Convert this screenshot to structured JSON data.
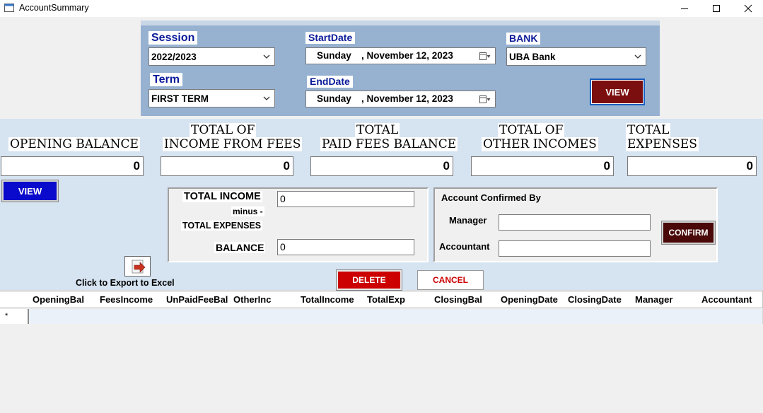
{
  "window": {
    "title": "AccountSummary",
    "controls": {
      "minimize": "—",
      "maximize": "☐",
      "close": "✕"
    }
  },
  "filter": {
    "session_label": "Session",
    "session_value": "2022/2023",
    "term_label": "Term",
    "term_value": "FIRST TERM",
    "start_label": "StartDate",
    "start_day": "Sunday",
    "start_rest": ", November 12, 2023",
    "end_label": "EndDate",
    "end_day": "Sunday",
    "end_rest": ", November 12, 2023",
    "bank_label": "BANK",
    "bank_value": "UBA Bank",
    "view_label": "VIEW"
  },
  "summary": {
    "opening_label": "OPENING BALANCE",
    "opening_value": "0",
    "fees_label_1": "TOTAL OF",
    "fees_label_2": "INCOME FROM FEES",
    "fees_value": "0",
    "paid_label_1": "TOTAL",
    "paid_label_2": "PAID FEES BALANCE",
    "paid_value": "0",
    "other_label_1": "TOTAL OF",
    "other_label_2": "OTHER INCOMES",
    "other_value": "0",
    "exp_label_1": "TOTAL",
    "exp_label_2": "EXPENSES",
    "exp_value": "0",
    "view_label": "VIEW"
  },
  "calc": {
    "income_label": "TOTAL INCOME",
    "income_value": "0",
    "minus_label": "minus -",
    "expenses_label": "TOTAL EXPENSES",
    "balance_label": "BALANCE",
    "balance_value": "0"
  },
  "confirm": {
    "title": "Account Confirmed By",
    "manager_label": "Manager",
    "manager_value": "",
    "accountant_label": "Accountant",
    "accountant_value": "",
    "confirm_label": "CONFIRM"
  },
  "actions": {
    "export_label": "Click to Export to Excel",
    "delete_label": "DELETE",
    "cancel_label": "CANCEL"
  },
  "grid": {
    "columns": [
      "OpeningBal",
      "FeesIncome",
      "UnPaidFeeBal",
      "OtherInc",
      "TotalIncome",
      "TotalExp",
      "ClosingBal",
      "OpeningDate",
      "ClosingDate",
      "Manager",
      "Accountant"
    ],
    "new_row_marker": "*"
  },
  "colors": {
    "panel_blue": "#97b2d1",
    "band_blue": "#d6e3f1",
    "label_navy": "#0a1a9a",
    "view_maroon": "#7b0e0e",
    "view_blue": "#0a0acc",
    "delete_red": "#cc0000",
    "cancel_text": "#cc0000",
    "confirm_dark": "#4a0808"
  }
}
